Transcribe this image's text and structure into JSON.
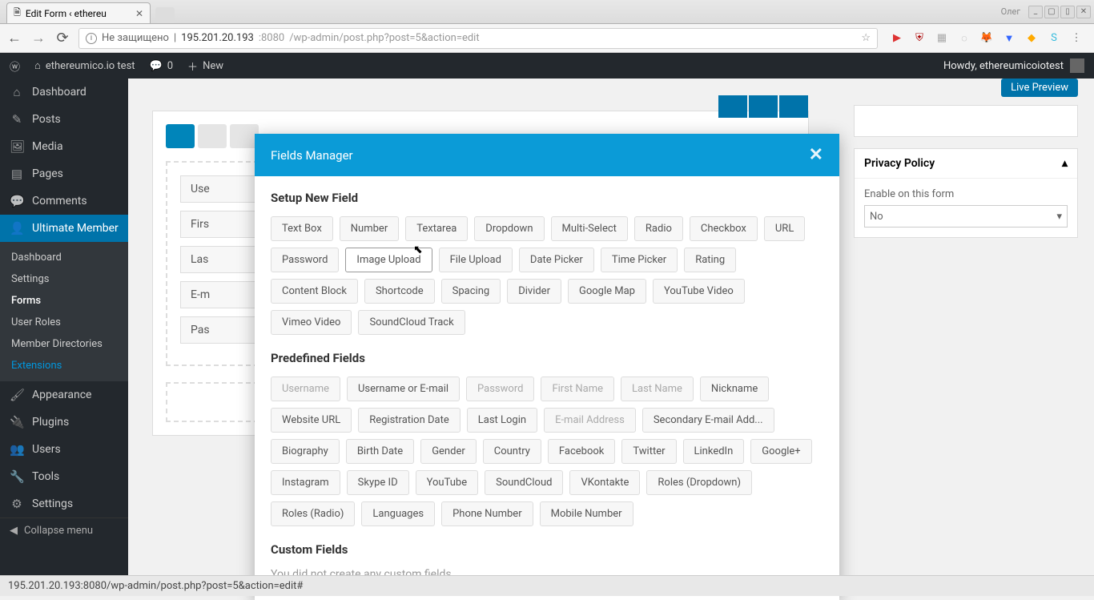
{
  "browser": {
    "tab_title": "Edit Form ‹ ethereu",
    "window_user": "Олег",
    "insecure_label": "Не защищено",
    "url_host": "195.201.20.193",
    "url_port": ":8080",
    "url_path": "/wp-admin/post.php?post=5&action=edit"
  },
  "wpbar": {
    "site_name": "ethereumico.io test",
    "comments": "0",
    "new_label": "New",
    "howdy": "Howdy, ethereumicoiotest"
  },
  "sidebar": {
    "items": [
      {
        "icon": "⌂",
        "label": "Dashboard"
      },
      {
        "icon": "✎",
        "label": "Posts"
      },
      {
        "icon": "🖼",
        "label": "Media"
      },
      {
        "icon": "▤",
        "label": "Pages"
      },
      {
        "icon": "💬",
        "label": "Comments"
      },
      {
        "icon": "👤",
        "label": "Ultimate Member"
      }
    ],
    "submenu": [
      "Dashboard",
      "Settings",
      "Forms",
      "User Roles",
      "Member Directories",
      "Extensions"
    ],
    "bottom": [
      {
        "icon": "🖌",
        "label": "Appearance"
      },
      {
        "icon": "🔌",
        "label": "Plugins"
      },
      {
        "icon": "👥",
        "label": "Users"
      },
      {
        "icon": "🔧",
        "label": "Tools"
      },
      {
        "icon": "⚙",
        "label": "Settings"
      }
    ],
    "collapse": "Collapse menu"
  },
  "content": {
    "live_preview": "Live Preview",
    "privacy_box": {
      "title": "Privacy Policy",
      "label": "Enable on this form",
      "value": "No"
    },
    "field_rows": [
      "Use",
      "Firs",
      "Las",
      "E-m",
      "Pas"
    ]
  },
  "modal": {
    "title": "Fields Manager",
    "section1": "Setup New Field",
    "new_fields": [
      "Text Box",
      "Number",
      "Textarea",
      "Dropdown",
      "Multi-Select",
      "Radio",
      "Checkbox",
      "URL",
      "Password",
      "Image Upload",
      "File Upload",
      "Date Picker",
      "Time Picker",
      "Rating",
      "Content Block",
      "Shortcode",
      "Spacing",
      "Divider",
      "Google Map",
      "YouTube Video",
      "Vimeo Video",
      "SoundCloud Track"
    ],
    "section2": "Predefined Fields",
    "predefined": [
      {
        "label": "Username",
        "disabled": true
      },
      {
        "label": "Username or E-mail",
        "disabled": false
      },
      {
        "label": "Password",
        "disabled": true
      },
      {
        "label": "First Name",
        "disabled": true
      },
      {
        "label": "Last Name",
        "disabled": true
      },
      {
        "label": "Nickname",
        "disabled": false
      },
      {
        "label": "Website URL",
        "disabled": false
      },
      {
        "label": "Registration Date",
        "disabled": false
      },
      {
        "label": "Last Login",
        "disabled": false
      },
      {
        "label": "E-mail Address",
        "disabled": true
      },
      {
        "label": "Secondary E-mail Add...",
        "disabled": false
      },
      {
        "label": "Biography",
        "disabled": false
      },
      {
        "label": "Birth Date",
        "disabled": false
      },
      {
        "label": "Gender",
        "disabled": false
      },
      {
        "label": "Country",
        "disabled": false
      },
      {
        "label": "Facebook",
        "disabled": false
      },
      {
        "label": "Twitter",
        "disabled": false
      },
      {
        "label": "LinkedIn",
        "disabled": false
      },
      {
        "label": "Google+",
        "disabled": false
      },
      {
        "label": "Instagram",
        "disabled": false
      },
      {
        "label": "Skype ID",
        "disabled": false
      },
      {
        "label": "YouTube",
        "disabled": false
      },
      {
        "label": "SoundCloud",
        "disabled": false
      },
      {
        "label": "VKontakte",
        "disabled": false
      },
      {
        "label": "Roles (Dropdown)",
        "disabled": false
      },
      {
        "label": "Roles (Radio)",
        "disabled": false
      },
      {
        "label": "Languages",
        "disabled": false
      },
      {
        "label": "Phone Number",
        "disabled": false
      },
      {
        "label": "Mobile Number",
        "disabled": false
      }
    ],
    "section3": "Custom Fields",
    "empty": "You did not create any custom fields"
  },
  "statusbar": "195.201.20.193:8080/wp-admin/post.php?post=5&action=edit#"
}
